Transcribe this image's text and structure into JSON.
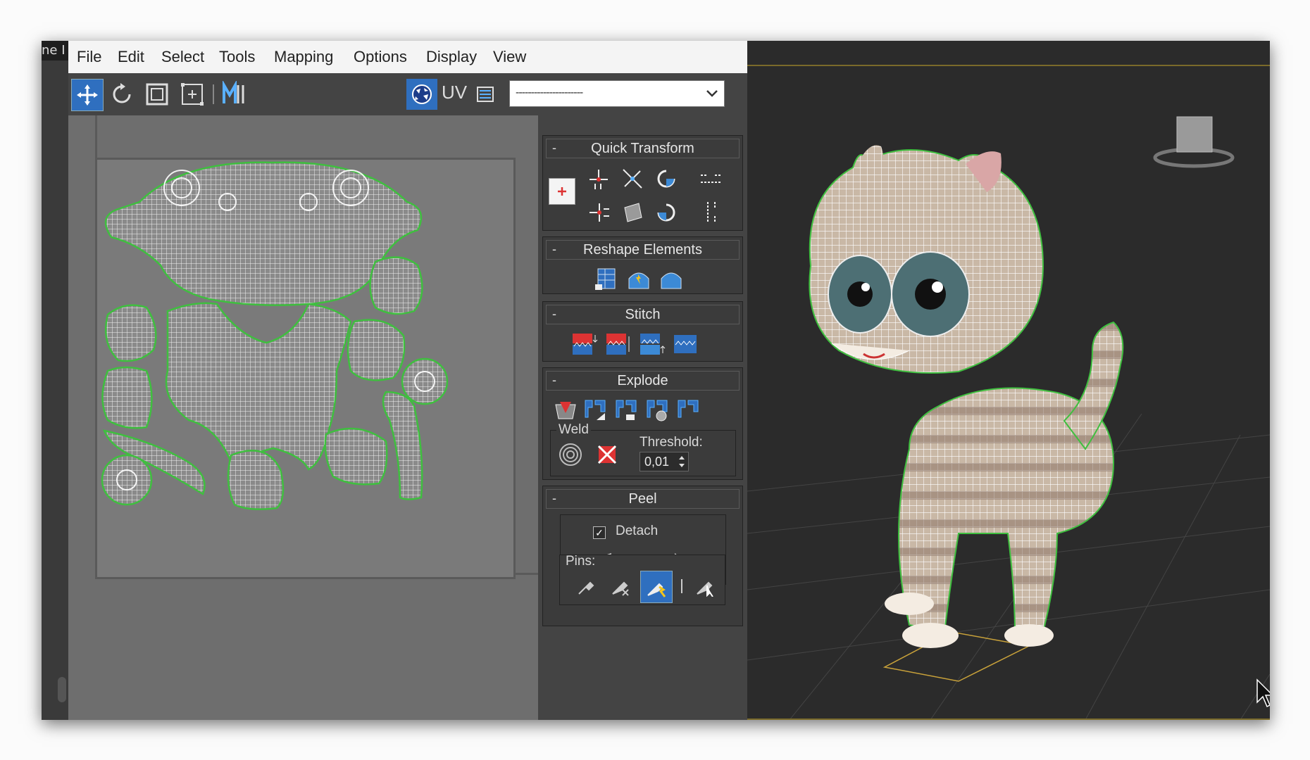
{
  "host": {
    "title_fragment": "ne I"
  },
  "menu": {
    "file": "File",
    "edit": "Edit",
    "select": "Select",
    "tools": "Tools",
    "mapping": "Mapping",
    "options": "Options",
    "display": "Display",
    "view": "View"
  },
  "toolbar": {
    "uv_label": "UV",
    "dropdown_value": "----------------------",
    "icons": [
      "move-icon",
      "rotate-icon",
      "scale-icon",
      "freeform-icon",
      "mirror-icon",
      "checker-map-icon",
      "uv-icon",
      "list-icon"
    ]
  },
  "panel": {
    "quick_transform": {
      "title": "Quick Transform",
      "collapse": "-"
    },
    "reshape_elements": {
      "title": "Reshape Elements",
      "collapse": "-"
    },
    "stitch": {
      "title": "Stitch",
      "collapse": "-"
    },
    "explode": {
      "title": "Explode",
      "collapse": "-"
    },
    "weld": {
      "label": "Weld",
      "threshold_label": "Threshold:",
      "threshold_value": "0,01"
    },
    "peel": {
      "title": "Peel",
      "collapse": "-",
      "detach_label": "Detach",
      "detach_checked": true,
      "pins_label": "Pins:"
    }
  },
  "colors": {
    "seam_green": "#3fbf3f",
    "wire_white": "#ffffff",
    "viewport_bg": "#2b2b2b",
    "panel_bg": "#444444",
    "highlight_blue": "#2f6fbf",
    "cat_body": "#c9b8a6"
  }
}
